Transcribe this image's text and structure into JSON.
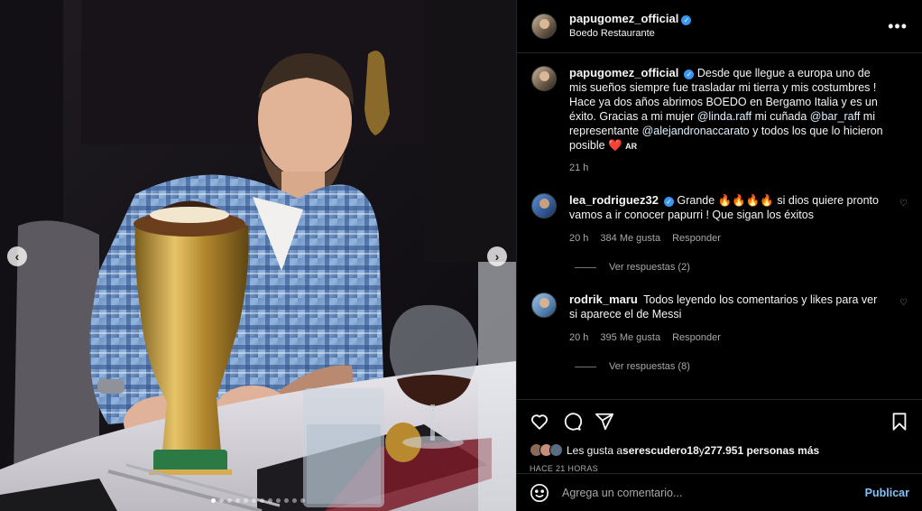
{
  "post": {
    "username": "papugomez_official",
    "location": "Boedo Restaurante"
  },
  "caption": {
    "username": "papugomez_official",
    "text_1": "Desde que llegue a europa uno de mis sueños siempre fue trasladar mi tierra y mis costumbres ! Hace ya dos años abrimos BOEDO en Bergamo Italia y es un éxito. Gracias a mi mujer ",
    "mention_1": "@linda.raff",
    "text_2": " mi cuñada ",
    "mention_2": "@bar_raff",
    "text_3": " mi representante ",
    "mention_3": "@alejandronaccarato",
    "text_4": " y todos los que lo hicieron posible ",
    "heart": "❤️",
    "flag": "AR",
    "time": "21 h"
  },
  "comments": [
    {
      "username": "lea_rodriguez32",
      "text": "Grande 🔥🔥🔥🔥 si dios quiere pronto vamos a ir conocer papurri ! Que sigan los éxitos",
      "time": "20 h",
      "likes": "384 Me gusta",
      "reply": "Responder",
      "view_replies": "Ver respuestas (2)"
    },
    {
      "username": "rodrik_maru",
      "text": "Todos leyendo los comentarios y likes para ver si aparece el de Messi",
      "time": "20 h",
      "likes": "395 Me gusta",
      "reply": "Responder",
      "view_replies": "Ver respuestas (8)"
    }
  ],
  "likes": {
    "prefix": "Les gusta a ",
    "user": "serescudero18",
    "middle": " y ",
    "count": "277.951 personas más"
  },
  "timestamp": "HACE 21 HORAS",
  "add_comment": {
    "placeholder": "Agrega un comentario...",
    "publish": "Publicar"
  },
  "carousel": {
    "slides": 12,
    "active_index": 0
  },
  "icons": [
    "heart-icon",
    "comment-icon",
    "share-icon",
    "bookmark-icon",
    "emoji-icon",
    "more-icon",
    "verified-icon"
  ],
  "colors": {
    "background": "#000000",
    "text": "#f5f5f5",
    "muted": "#a8a8a8",
    "link": "#e0f1ff",
    "publish": "#85c1f6",
    "verified": "#3897f0"
  }
}
